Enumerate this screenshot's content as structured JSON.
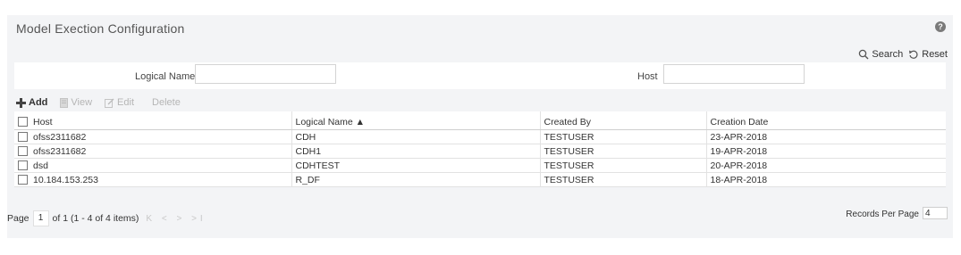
{
  "page": {
    "title": "Model Exection Configuration",
    "help": "?"
  },
  "actions": {
    "search": "Search",
    "reset": "Reset"
  },
  "filters": {
    "logical_name_label": "Logical Name",
    "logical_name_value": "",
    "host_label": "Host",
    "host_value": ""
  },
  "toolbar": {
    "add": "Add",
    "view": "View",
    "edit": "Edit",
    "delete": "Delete"
  },
  "table": {
    "columns": [
      "Host",
      "Logical Name ▲",
      "Created By",
      "Creation Date"
    ],
    "rows": [
      [
        "ofss2311682",
        "CDH",
        "TESTUSER",
        "23-APR-2018"
      ],
      [
        "ofss2311682",
        "CDH1",
        "TESTUSER",
        "19-APR-2018"
      ],
      [
        "dsd",
        "CDHTEST",
        "TESTUSER",
        "20-APR-2018"
      ],
      [
        "10.184.153.253",
        "R_DF",
        "TESTUSER",
        "18-APR-2018"
      ]
    ]
  },
  "pager": {
    "page_label": "Page",
    "page_value": "1",
    "summary": "of 1 (1 - 4 of 4 items)",
    "nav": "K < > >I",
    "records_label": "Records Per Page",
    "records_value": "4"
  }
}
